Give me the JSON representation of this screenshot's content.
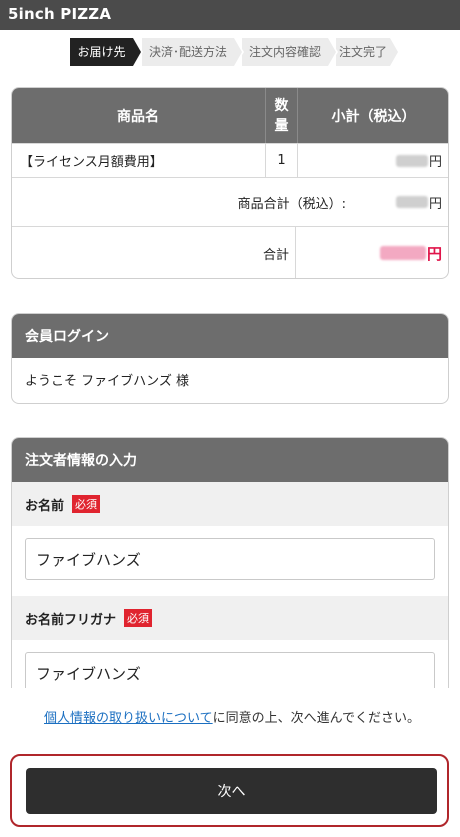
{
  "header": {
    "site_title": "5inch PIZZA"
  },
  "steps": [
    {
      "label": "お届け先",
      "active": true
    },
    {
      "label": "決済･配送方法",
      "active": false
    },
    {
      "label": "注文内容確認",
      "active": false
    },
    {
      "label": "注文完了",
      "active": false
    }
  ],
  "order_table": {
    "headers": {
      "name": "商品名",
      "qty_line1": "数",
      "qty_line2": "量",
      "subtotal": "小計（税込）"
    },
    "items": [
      {
        "name": "【ライセンス月額費用】",
        "qty": "1",
        "currency": "円"
      }
    ],
    "product_total_label": "商品合計（税込）:",
    "product_total_currency": "円",
    "total_label": "合計",
    "total_currency": "円"
  },
  "login_panel": {
    "title": "会員ログイン",
    "welcome": "ようこそ ファイブハンズ 様"
  },
  "customer_panel": {
    "title": "注文者情報の入力",
    "required_badge": "必須",
    "name_label": "お名前",
    "name_value": "ファイブハンズ",
    "kana_label": "お名前フリガナ",
    "kana_value": "ファイブハンズ"
  },
  "footer": {
    "privacy_link": "個人情報の取り扱いについて",
    "consent_text": "に同意の上、次へ進んでください。",
    "next_button": "次へ"
  },
  "colors": {
    "header_bg": "#4b4b4b",
    "panel_head_bg": "#6d6d6d",
    "required": "#e0242f",
    "total_price": "#e0144a",
    "link": "#1b6fc1",
    "button_outline": "#b0262b"
  }
}
